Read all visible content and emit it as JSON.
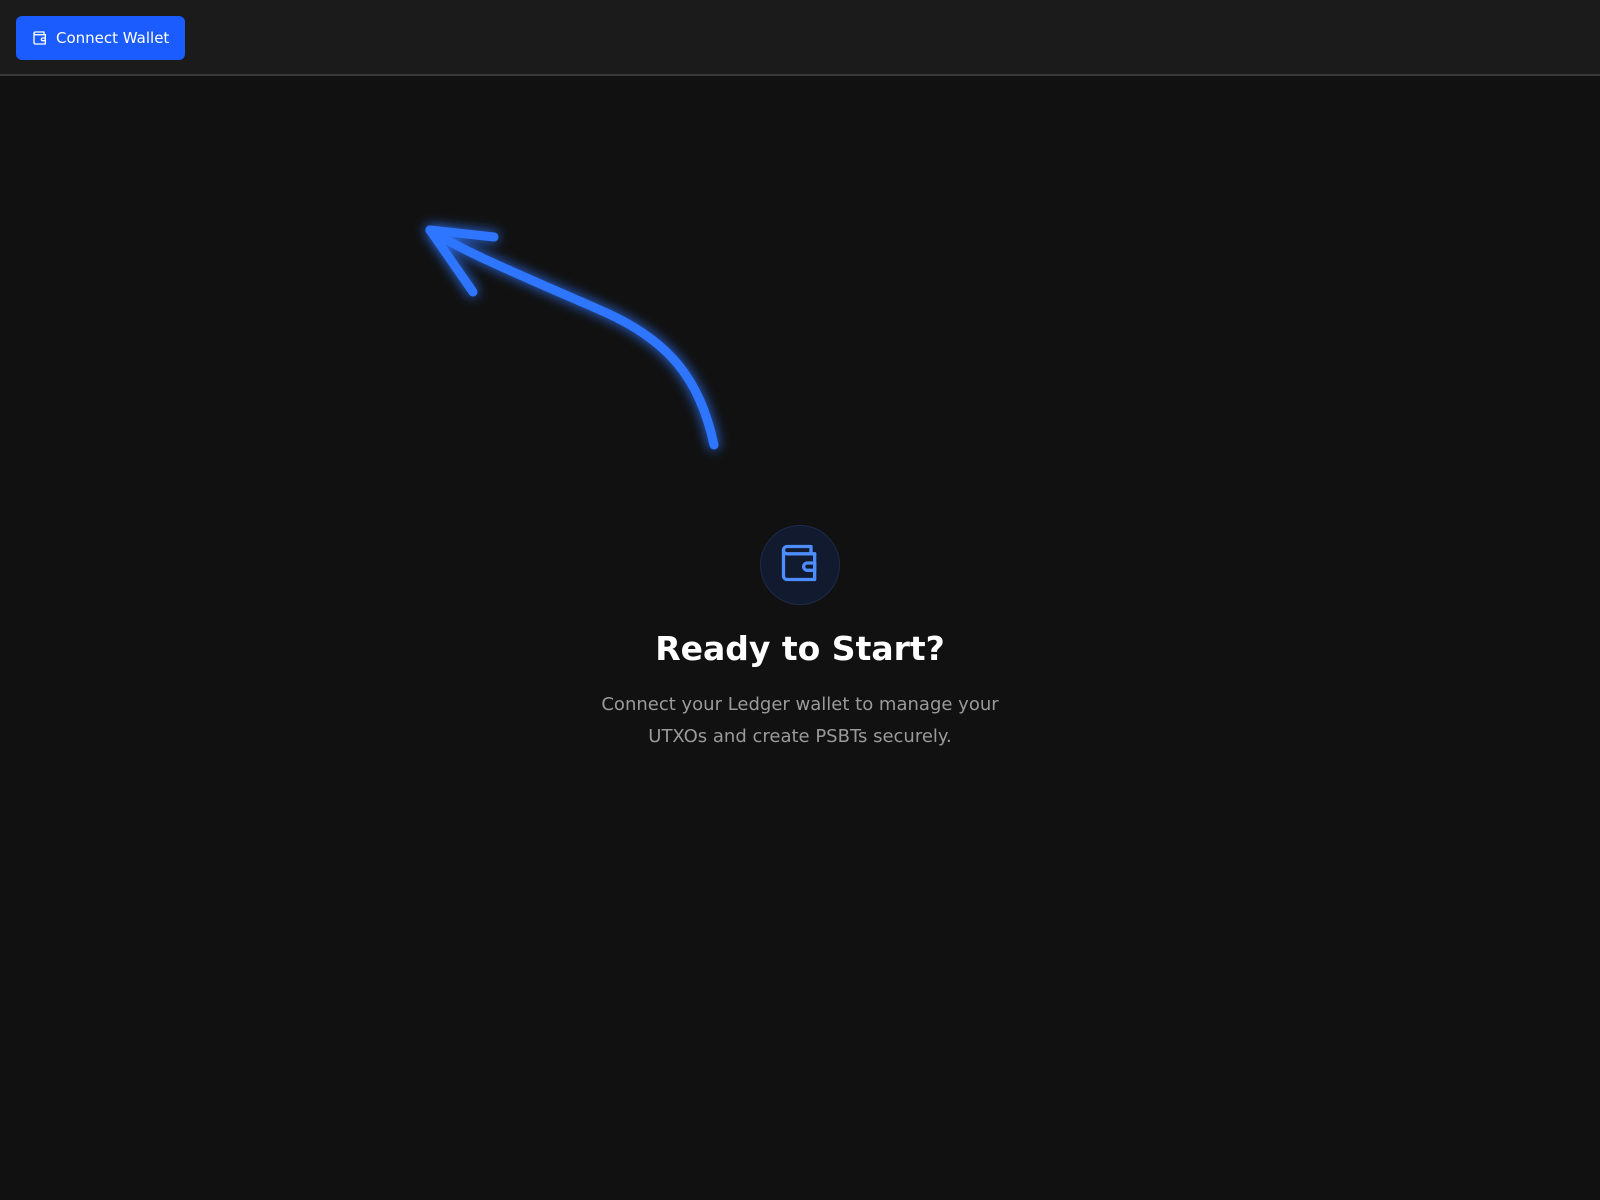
{
  "header": {
    "connect_button": {
      "label": "Connect Wallet",
      "icon": "wallet-icon"
    }
  },
  "hero": {
    "icon": "wallet-icon",
    "title": "Ready to Start?",
    "subtitle": "Connect your Ledger wallet to manage your UTXOs and create PSBTs securely."
  },
  "colors": {
    "background": "#111111",
    "header_background": "#1b1b1b",
    "accent": "#1a5cff",
    "arrow": "#2f75ff",
    "icon": "#4d8dff",
    "title": "#ffffff",
    "subtitle": "#9a9a9a"
  }
}
